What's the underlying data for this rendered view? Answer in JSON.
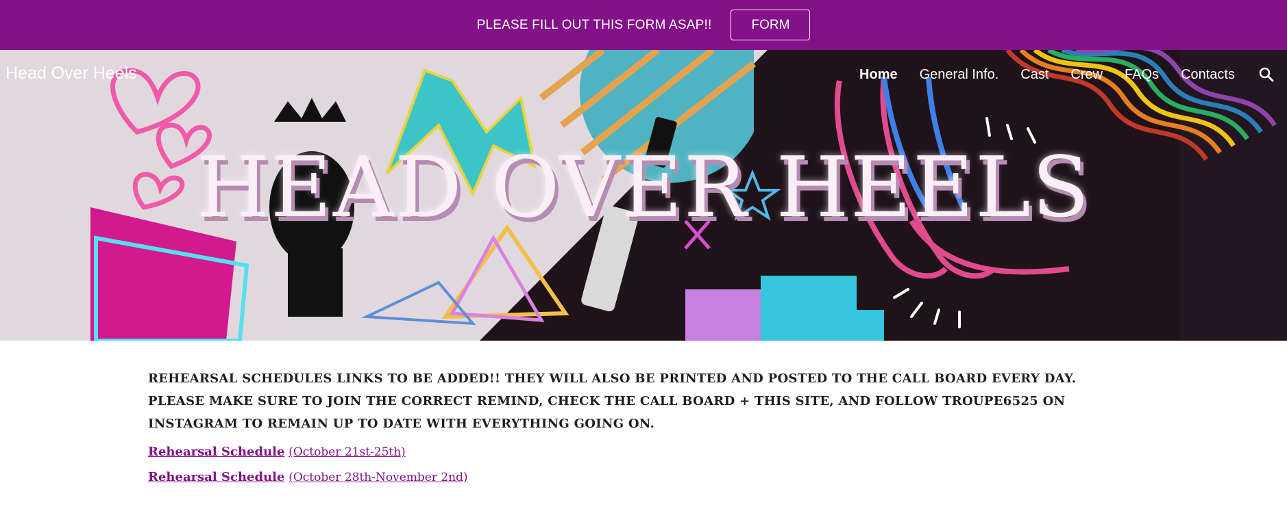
{
  "announcement": {
    "text": "PLEASE FILL OUT THIS FORM ASAP!!",
    "button_label": "FORM"
  },
  "header": {
    "site_title": "Head Over Heels",
    "nav": [
      {
        "label": "Home",
        "active": true
      },
      {
        "label": "General Info."
      },
      {
        "label": "Cast"
      },
      {
        "label": "Crew"
      },
      {
        "label": "FAQs"
      },
      {
        "label": "Contacts"
      }
    ],
    "search_icon": "search-icon",
    "hero_title": "HEAD OVER HEELS"
  },
  "content": {
    "notice": "REHEARSAL SCHEDULES LINKS TO BE ADDED!! THEY WILL ALSO BE PRINTED AND POSTED TO THE CALL BOARD EVERY DAY. PLEASE MAKE SURE TO JOIN THE CORRECT REMIND, CHECK THE CALL BOARD + THIS SITE, AND FOLLOW TROUPE6525 ON INSTAGRAM TO REMAIN UP TO DATE WITH EVERYTHING GOING ON.",
    "schedules": [
      {
        "label": "Rehearsal Schedule",
        "dates": "(October 21st-25th)"
      },
      {
        "label": "Rehearsal Schedule",
        "dates": "(October 28th-November 2nd)"
      }
    ]
  },
  "colors": {
    "accent": "#841189",
    "text": "#1f1f1f",
    "banner_light": "#e1d8de",
    "banner_dark": "#1f1219"
  }
}
